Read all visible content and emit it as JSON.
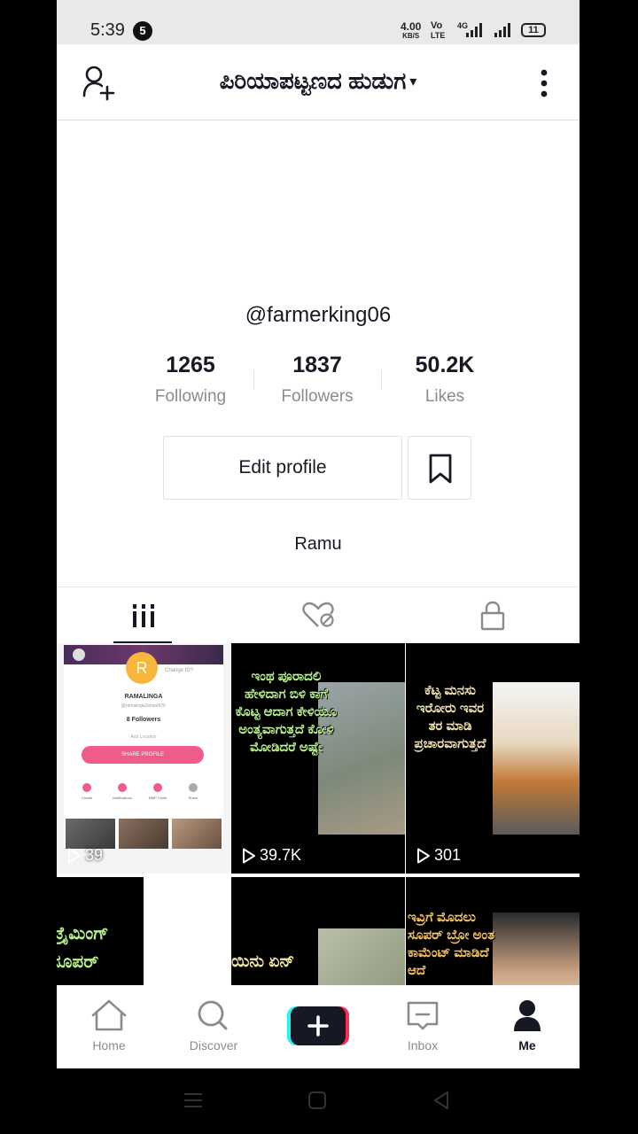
{
  "status_bar": {
    "time": "5:39",
    "notification_count": "5",
    "net_speed_value": "4.00",
    "net_speed_unit": "KB/S",
    "volte_top": "Vo",
    "volte_bottom": "LTE",
    "network_type": "4G",
    "battery": "11"
  },
  "header": {
    "title": "ಪಿರಿಯಾಪಟ್ಟಣದ ಹುಡುಗ",
    "caret": "▾"
  },
  "profile": {
    "username": "@farmerking06",
    "stats": [
      {
        "value": "1265",
        "label": "Following"
      },
      {
        "value": "1837",
        "label": "Followers"
      },
      {
        "value": "50.2K",
        "label": "Likes"
      }
    ],
    "edit_button_label": "Edit profile",
    "bio": "Ramu"
  },
  "videos": [
    {
      "views": "39",
      "embedded": {
        "avatar_letter": "R",
        "name": "RAMALINGA",
        "handle": "@ramalinga2shoot97F",
        "followers": "8 Followers",
        "share_label": "SHARE PROFILE",
        "change_label": "Change ID?",
        "add_label": "Add Location",
        "shortcut_labels": [
          "Create",
          "Notifications",
          "MMP Clubb",
          "Share"
        ]
      }
    },
    {
      "views": "39.7K",
      "caption": "ಇಂಥ ಪೂರಾದಲಿ ಹೇಳಿದಾಗ ಬಿಳಿ ಕಾಗೆ ಕೊಟ್ಟ ಆದಾಗ ಕೇಳಿಯೂ ಅಂತ್ಯವಾಗುತ್ತದೆ ಕೋಳಿ ಮೋಡಿದರೆ ಅಷ್ಟೇ"
    },
    {
      "views": "301",
      "caption": "ಕೆಟ್ಟ ಮನಸು ಇರೋರು ಇವರ ತರ ಮಾಡಿ ಪ್ರಚಾರವಾಗುತ್ತದೆ",
      "emoji": "😀😀"
    },
    {
      "caption": "ಟ್ರೈಮಿಂಗ್ ಸೂಪರ್"
    },
    {
      "caption": "ಯಿನು ಏನ್"
    },
    {
      "caption": "ಇವ್ರಿಗೆ ಮೊದಲು ಸೂಪರ್ ಬ್ರೋ ಅಂತ ಕಾಮೆಂಟ್ ಮಾಡಿದೆ ಆದೆ"
    }
  ],
  "nav": [
    {
      "label": "Home",
      "icon": "home-icon"
    },
    {
      "label": "Discover",
      "icon": "search-icon"
    },
    {
      "label": "",
      "icon": "plus-icon"
    },
    {
      "label": "Inbox",
      "icon": "inbox-icon"
    },
    {
      "label": "Me",
      "icon": "profile-icon"
    }
  ],
  "colors": {
    "accent": "#161823",
    "secondary_text": "#8a8b91",
    "cyan": "#25f4ee",
    "pink": "#fe2c55"
  }
}
